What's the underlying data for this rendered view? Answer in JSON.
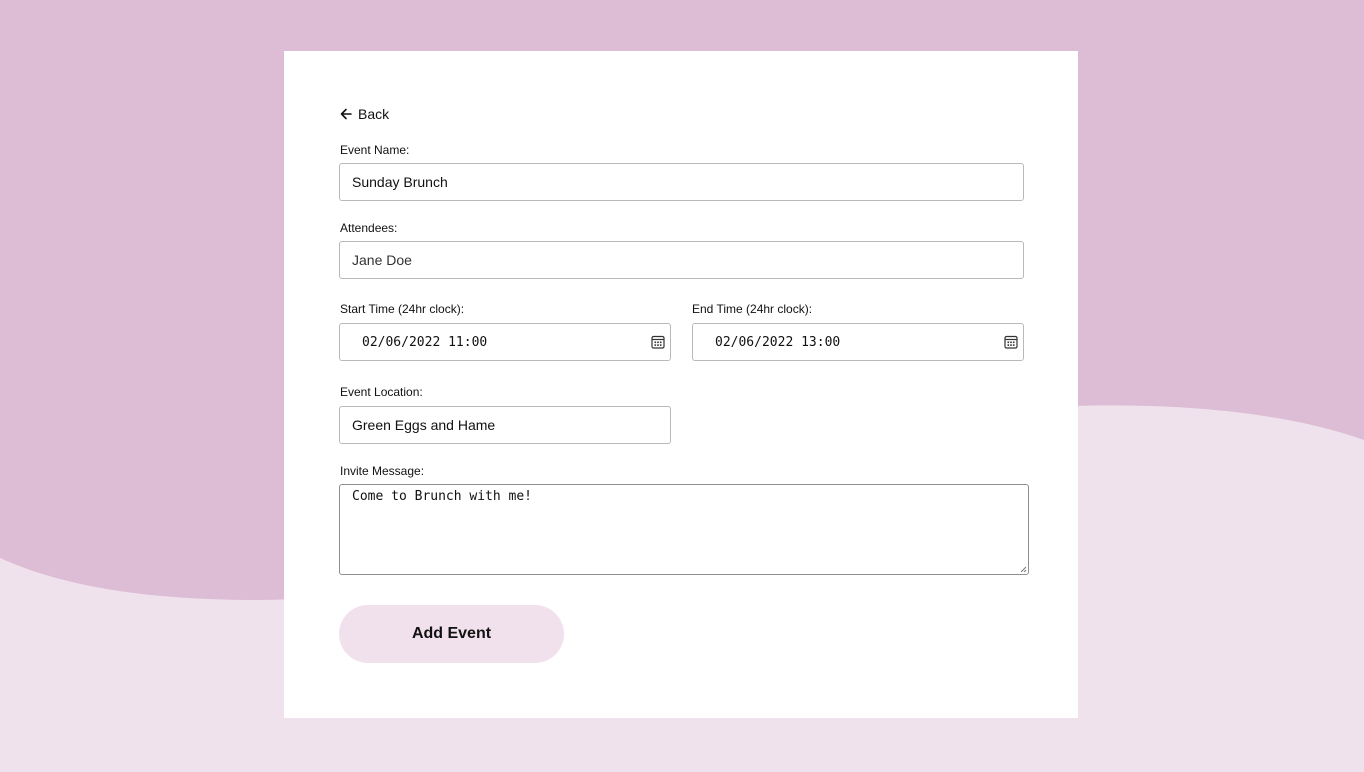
{
  "colors": {
    "background_top": "#dcbdd5",
    "background_bottom": "#f0e2ec",
    "card": "#ffffff",
    "button": "#f1e1ec"
  },
  "nav": {
    "back_label": "Back",
    "back_icon": "arrow-left-icon"
  },
  "form": {
    "event_name": {
      "label": "Event Name:",
      "value": "Sunday Brunch"
    },
    "attendees": {
      "label": "Attendees:",
      "value": "Jane Doe"
    },
    "start_time": {
      "label": "Start Time (24hr clock):",
      "value": "02/06/2022 11:00",
      "icon": "calendar-icon"
    },
    "end_time": {
      "label": "End Time (24hr clock):",
      "value": "02/06/2022 13:00",
      "icon": "calendar-icon"
    },
    "location": {
      "label": "Event Location:",
      "value": "Green Eggs and Hame"
    },
    "message": {
      "label": "Invite Message:",
      "value": "Come to Brunch with me!"
    },
    "submit_label": "Add Event"
  }
}
